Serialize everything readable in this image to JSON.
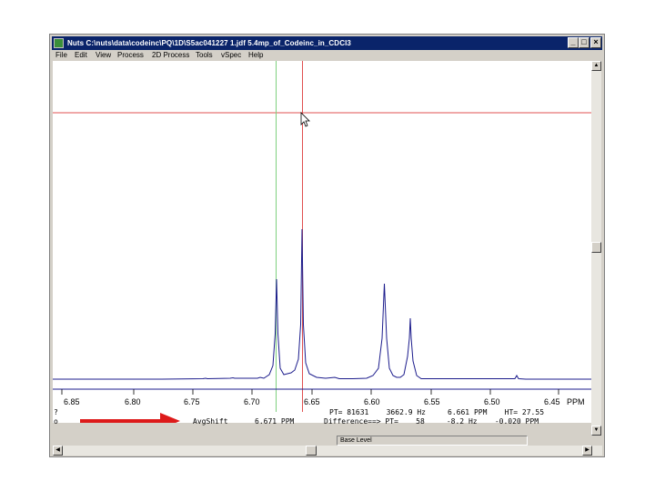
{
  "window": {
    "title": "Nuts  C:\\nuts\\data\\codeinc\\PQ\\1D\\S5ac041227 1.jdf  5.4mp_of_Codeinc_in_CDCl3",
    "minimize": "_",
    "maximize": "□",
    "close": "×"
  },
  "menu": [
    "File",
    "Edit",
    "View",
    "Process",
    "2D Process",
    "Tools",
    "vSpec",
    "Help"
  ],
  "axis": {
    "ticks": [
      "6.85",
      "6.80",
      "6.75",
      "6.70",
      "6.65",
      "6.60",
      "6.55",
      "6.50",
      "6.45"
    ],
    "unit": "PPM"
  },
  "info": {
    "left_marker_1": "?",
    "left_marker_2": "o",
    "line1": "PT= 81631    3662.9 Hz     6.661 PPM    HT= 27.55",
    "avg_shift_label": "AvgShift",
    "avg_shift_value": "6.671 PPM",
    "line2": "Difference==> PT=    58     -8.2 Hz    -0.020 PPM"
  },
  "status": {
    "field": "Base Level"
  },
  "colors": {
    "spectrum": "#1c1c8c",
    "cursor_green": "#7fd07f",
    "cursor_red": "#e05050",
    "arrow": "#dd1a1a",
    "titlebar": "#0a246a"
  }
}
